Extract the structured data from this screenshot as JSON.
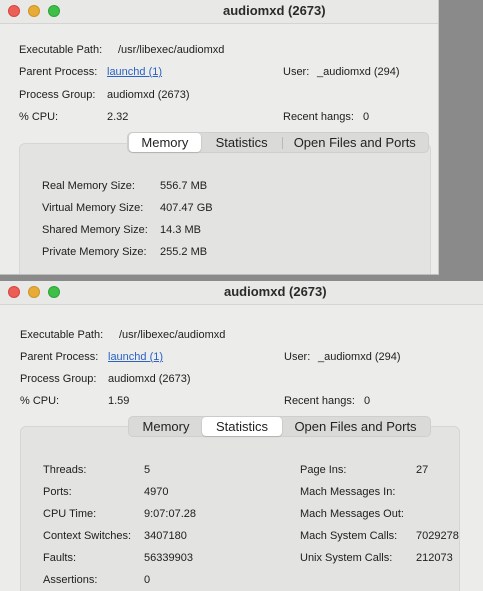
{
  "windows": [
    {
      "title": "audiomxd (2673)",
      "executable_path_label": "Executable Path:",
      "executable_path": "/usr/libexec/audiomxd",
      "parent_process_label": "Parent Process:",
      "parent_process": "launchd (1)",
      "user_label": "User:",
      "user": "_audiomxd (294)",
      "process_group_label": "Process Group:",
      "process_group": "audiomxd (2673)",
      "cpu_label": "% CPU:",
      "cpu": "2.32",
      "recent_hangs_label": "Recent hangs:",
      "recent_hangs": "0",
      "tabs": [
        "Memory",
        "Statistics",
        "Open Files and Ports"
      ],
      "selected_tab": "Memory",
      "memory": {
        "real_label": "Real Memory Size:",
        "real": "556.7 MB",
        "virtual_label": "Virtual Memory Size:",
        "virtual": "407.47 GB",
        "shared_label": "Shared Memory Size:",
        "shared": "14.3 MB",
        "private_label": "Private Memory Size:",
        "private": "255.2 MB"
      }
    },
    {
      "title": "audiomxd (2673)",
      "executable_path_label": "Executable Path:",
      "executable_path": "/usr/libexec/audiomxd",
      "parent_process_label": "Parent Process:",
      "parent_process": "launchd (1)",
      "user_label": "User:",
      "user": "_audiomxd (294)",
      "process_group_label": "Process Group:",
      "process_group": "audiomxd (2673)",
      "cpu_label": "% CPU:",
      "cpu": "1.59",
      "recent_hangs_label": "Recent hangs:",
      "recent_hangs": "0",
      "tabs": [
        "Memory",
        "Statistics",
        "Open Files and Ports"
      ],
      "selected_tab": "Statistics",
      "statistics": {
        "left": [
          {
            "label": "Threads:",
            "value": "5"
          },
          {
            "label": "Ports:",
            "value": "4970"
          },
          {
            "label": "CPU Time:",
            "value": "9:07:07.28"
          },
          {
            "label": "Context Switches:",
            "value": "3407180"
          },
          {
            "label": "Faults:",
            "value": "56339903"
          },
          {
            "label": "Assertions:",
            "value": "0"
          }
        ],
        "right": [
          {
            "label": "Page Ins:",
            "value": "27"
          },
          {
            "label": "Mach Messages In:",
            "value": ""
          },
          {
            "label": "Mach Messages Out:",
            "value": ""
          },
          {
            "label": "Mach System Calls:",
            "value": "7029278"
          },
          {
            "label": "Unix System Calls:",
            "value": "212073"
          }
        ]
      }
    }
  ],
  "colors": {
    "link": "#2b62c4",
    "close": "#ec5f57",
    "minimize": "#e7ac36",
    "zoom": "#3fbf47"
  }
}
